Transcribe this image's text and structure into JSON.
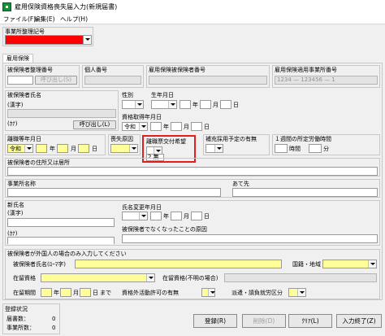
{
  "window": {
    "title": "雇用保険資格喪失届入力(新規届書)"
  },
  "menu": {
    "file": "ファイル(F)",
    "edit": "編集(E)",
    "help": "ヘルプ(H)"
  },
  "office_code": {
    "label": "事業所整理記号"
  },
  "tab": {
    "label": "雇用保険"
  },
  "fields": {
    "insured_number": {
      "label": "被保険者整理番号",
      "button": "呼び出し(S)"
    },
    "individual_number": {
      "label": "個人番号"
    },
    "insurance_number": {
      "label": "雇用保険被保険者番号"
    },
    "office_number": {
      "label": "雇用保険適用事業所番号",
      "placeholder": "1234 — 123456 — 1"
    },
    "insured_name": {
      "label": "被保険者氏名",
      "kanji": "(漢字)",
      "kana": "(ｶﾅ)",
      "button": "呼び出し(L)"
    },
    "gender": {
      "label": "性別"
    },
    "birth_date": {
      "label": "生年月日",
      "year": "年",
      "month": "月",
      "day": "日"
    },
    "acquisition_date": {
      "label": "資格取得年月日",
      "era": "令和",
      "year": "年",
      "month": "月",
      "day": "日"
    },
    "separation_date": {
      "label": "離職等年月日",
      "era": "令和",
      "year": "年",
      "month": "月",
      "day": "日"
    },
    "loss_reason": {
      "label": "喪失原因"
    },
    "certificate_request": {
      "label": "離職票交付希望",
      "value": "2 無"
    },
    "rehire_plan": {
      "label": "補充採用予定の有無"
    },
    "weekly_hours": {
      "label": "１週間の所定労働時間",
      "hours": "時間",
      "minutes": "分"
    },
    "address": {
      "label": "被保険者の住所又は居所"
    },
    "office_name": {
      "label": "事業所名称"
    },
    "destination": {
      "label": "あて先"
    },
    "new_name": {
      "label": "新氏名",
      "kanji": "(漢字)",
      "kana": "(ｶﾅ)"
    },
    "name_change_date": {
      "label": "氏名変更年月日",
      "year": "年",
      "month": "月",
      "day": "日"
    },
    "not_insured_reason": {
      "label": "被保険者でなくなったことの原因"
    },
    "foreigner": {
      "label": "被保険者が外国人の場合のみ入力してください",
      "name_roman": "被保険者氏名(ﾛｰﾏ字)",
      "nationality": "国籍・地域",
      "residence_status": "在留資格",
      "residence_status_code": "在留資格(不明の場合)",
      "residence_period": "在留期間",
      "year": "年",
      "month": "月",
      "day": "日",
      "until": "まで",
      "permission": "資格外活動許可の有無",
      "dispatch": "派遣・請負就労区分"
    }
  },
  "status": {
    "title": "登録状況",
    "forms_label": "届書数：",
    "forms_count": "0",
    "offices_label": "事業所数：",
    "offices_count": "0"
  },
  "buttons": {
    "register": "登録(R)",
    "delete": "削除(D)",
    "clear": "ｸﾘｱ(L)",
    "finish": "入力終了(Z)"
  }
}
